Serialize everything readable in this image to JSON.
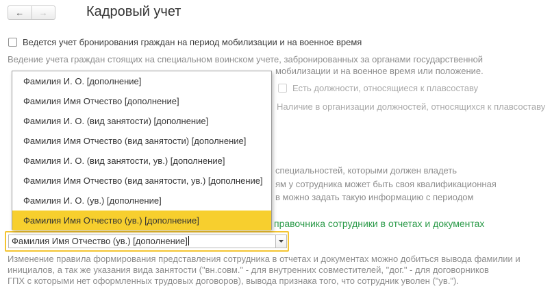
{
  "header": {
    "title": "Кадровый учет",
    "back_label": "←",
    "forward_label": "→"
  },
  "mobilization": {
    "checkbox_label": "Ведется учет бронирования граждан на период мобилизации и на военное время",
    "checked": false,
    "description_line1": "Ведение учета граждан стоящих на специальном воинском учете, забронированных за органами государственной",
    "description_line2_visible": "мобилизации и на военное время или положение."
  },
  "plavsostav": {
    "checkbox_label": "Есть должности, относящиеся к плавсоставу",
    "checked": false,
    "description": "Наличие в организации должностей, относящихся к плавсоставу"
  },
  "qualification": {
    "line1_visible": "специальностей, которыми должен владеть",
    "line2_visible": "ям у сотрудника может быть своя квалификационная",
    "line3_visible": "в можно задать такую информацию с периодом"
  },
  "representation": {
    "heading_visible": "правочника сотрудники в отчетах и документах",
    "combo_value": "Фамилия Имя Отчество (ув.) [дополнение]",
    "options": [
      "Фамилия И. О. [дополнение]",
      "Фамилия Имя Отчество [дополнение]",
      "Фамилия И. О. (вид занятости) [дополнение]",
      "Фамилия Имя Отчество (вид занятости) [дополнение]",
      "Фамилия И. О. (вид занятости, ув.) [дополнение]",
      "Фамилия Имя Отчество (вид занятости, ув.) [дополнение]",
      "Фамилия И. О. (ув.) [дополнение]",
      "Фамилия Имя Отчество (ув.) [дополнение]"
    ],
    "selected_index": 7,
    "description_line1": "Изменение правила формирования представления сотрудника в отчетах и документах можно добиться вывода фамилии и",
    "description_line2": "инициалов, а так же указания вида занятости (\"вн.совм.\" - для внутренних совместителей, \"дог.\" - для договорников",
    "description_line3": "ГПХ с которыми нет оформленных трудовых договоров), вывода признака того, что сотрудник уволен (\"ув.\")."
  },
  "colors": {
    "accent_yellow": "#f7cf2e",
    "focus_border": "#f4c430",
    "section_green": "#2a9a48",
    "hint_gray": "#8c8c8c"
  }
}
